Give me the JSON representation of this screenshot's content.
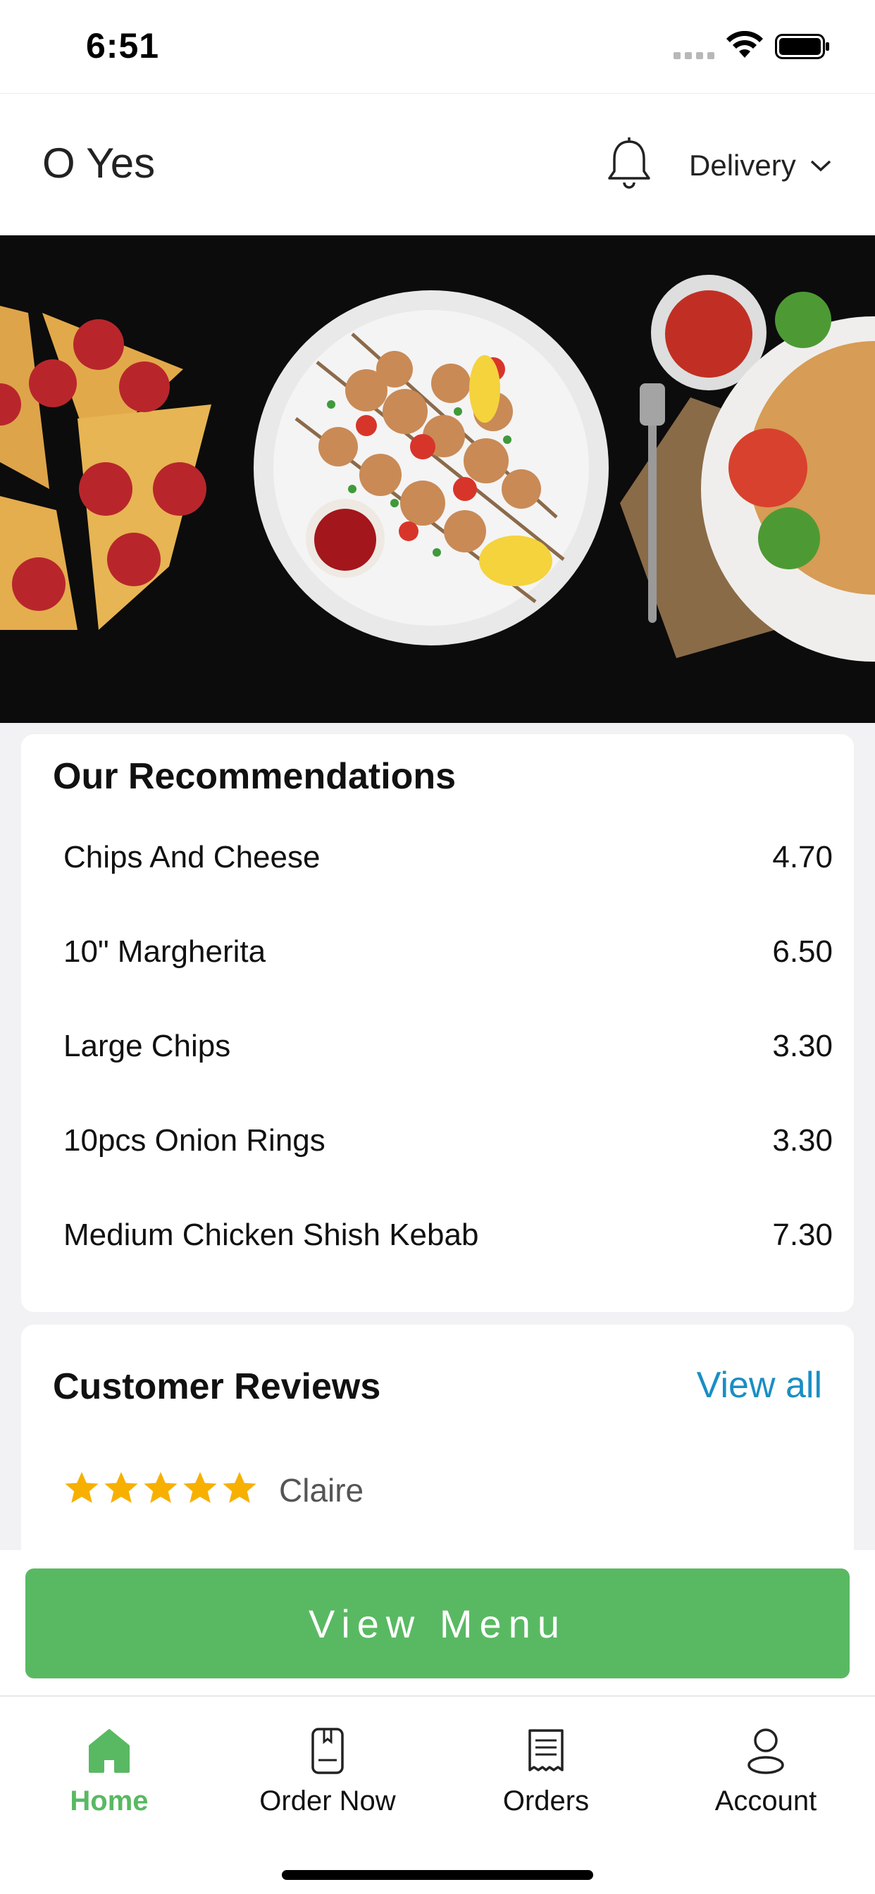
{
  "status_bar": {
    "time": "6:51"
  },
  "header": {
    "app_title": "O Yes",
    "delivery_label": "Delivery"
  },
  "hero": {
    "icon": "food-banner-image"
  },
  "recommendations": {
    "title": "Our Recommendations",
    "items": [
      {
        "name": "Chips And Cheese",
        "price": "4.70"
      },
      {
        "name": "10\" Margherita",
        "price": "6.50"
      },
      {
        "name": "Large Chips",
        "price": "3.30"
      },
      {
        "name": "10pcs Onion Rings",
        "price": "3.30"
      },
      {
        "name": "Medium Chicken Shish Kebab",
        "price": "7.30"
      }
    ]
  },
  "reviews": {
    "title": "Customer Reviews",
    "view_all": "View all",
    "first_review": {
      "rating": 5,
      "max_rating": 5,
      "reviewer": "Claire"
    }
  },
  "view_menu_label": "View Menu",
  "tabs": [
    {
      "label": "Home",
      "icon": "home-icon",
      "active": true
    },
    {
      "label": "Order Now",
      "icon": "menu-book-icon",
      "active": false
    },
    {
      "label": "Orders",
      "icon": "receipt-icon",
      "active": false
    },
    {
      "label": "Account",
      "icon": "user-icon",
      "active": false
    }
  ],
  "colors": {
    "accent_green": "#59b962",
    "link_blue": "#1a8ec4",
    "star_gold": "#f7b000"
  }
}
